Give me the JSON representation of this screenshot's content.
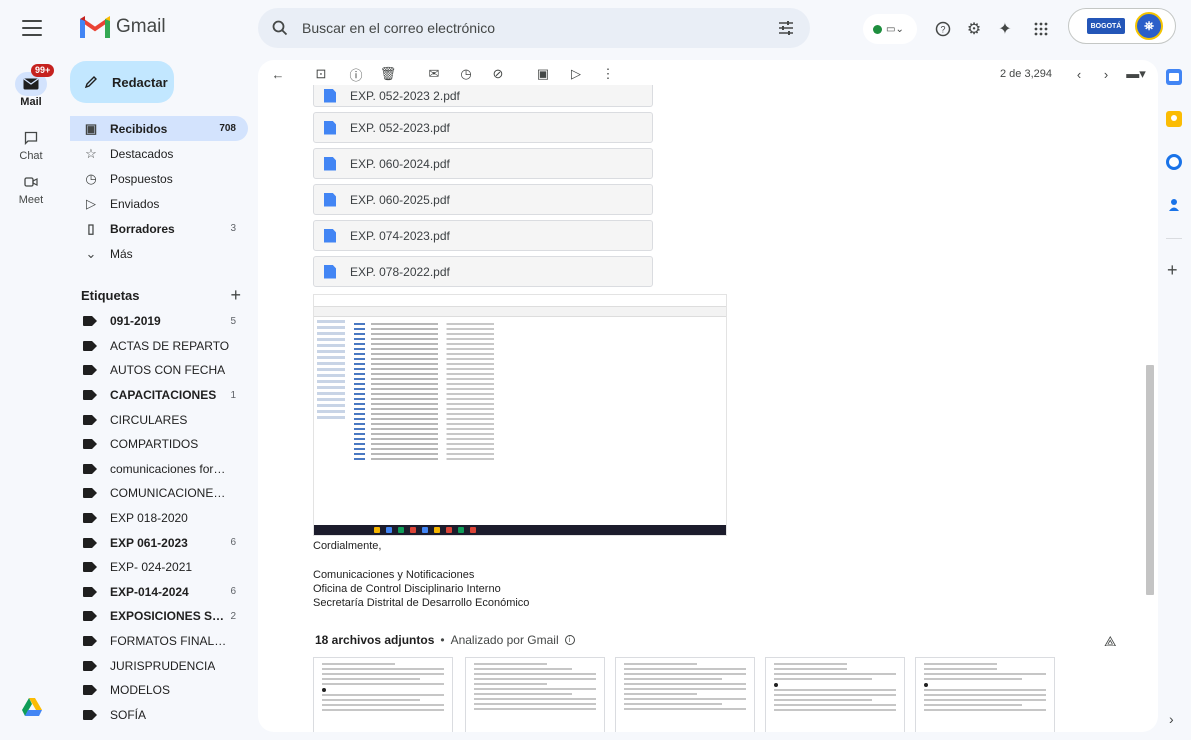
{
  "app": {
    "name": "Gmail"
  },
  "header": {
    "search_placeholder": "Buscar en el correo electrónico",
    "account_logo_text": "BOGOTÁ"
  },
  "rail": {
    "mail_label": "Mail",
    "mail_badge": "99+",
    "chat_label": "Chat",
    "meet_label": "Meet"
  },
  "compose": {
    "label": "Redactar"
  },
  "nav": [
    {
      "label": "Recibidos",
      "count": "708",
      "icon": "inbox-icon",
      "active": true
    },
    {
      "label": "Destacados",
      "count": "",
      "icon": "star-icon"
    },
    {
      "label": "Pospuestos",
      "count": "",
      "icon": "clock-icon"
    },
    {
      "label": "Enviados",
      "count": "",
      "icon": "send-icon"
    },
    {
      "label": "Borradores",
      "count": "3",
      "icon": "draft-icon",
      "bold": true
    },
    {
      "label": "Más",
      "count": "",
      "icon": "chevron-down-icon"
    }
  ],
  "labels_title": "Etiquetas",
  "labels": [
    {
      "name": "091-2019",
      "count": "5",
      "bold": true
    },
    {
      "name": "ACTAS DE REPARTO",
      "count": ""
    },
    {
      "name": "AUTOS CON FECHA",
      "count": ""
    },
    {
      "name": "CAPACITACIONES",
      "count": "1",
      "bold": true
    },
    {
      "name": "CIRCULARES",
      "count": ""
    },
    {
      "name": "COMPARTIDOS",
      "count": ""
    },
    {
      "name": "comunicaciones formato...",
      "count": ""
    },
    {
      "name": "COMUNICACIONES Y/O ...",
      "count": ""
    },
    {
      "name": "EXP 018-2020",
      "count": ""
    },
    {
      "name": "EXP 061-2023",
      "count": "6",
      "bold": true
    },
    {
      "name": "EXP- 024-2021",
      "count": ""
    },
    {
      "name": "EXP-014-2024",
      "count": "6",
      "bold": true
    },
    {
      "name": "EXPOSICIONES SE...",
      "count": "2",
      "bold": true
    },
    {
      "name": "FORMATOS FINALES PR...",
      "count": ""
    },
    {
      "name": "JURISPRUDENCIA",
      "count": ""
    },
    {
      "name": "MODELOS",
      "count": ""
    },
    {
      "name": "SOFÍA",
      "count": ""
    }
  ],
  "toolbar": {
    "pager": "2 de 3,294"
  },
  "pdfs": [
    "EXP. 052-2023 2.pdf",
    "EXP. 052-2023.pdf",
    "EXP. 060-2024.pdf",
    "EXP. 060-2025.pdf",
    "EXP. 074-2023.pdf",
    "EXP. 078-2022.pdf"
  ],
  "signature": {
    "closing": "Cordialmente,",
    "line1": "Comunicaciones y Notificaciones",
    "line2": "Oficina de Control Disciplinario Interno",
    "line3": "Secretaría Distrital de Desarrollo Económico"
  },
  "attachments": {
    "title": "18 archivos adjuntos",
    "subtitle": "Analizado por Gmail",
    "separator": "•"
  },
  "colors": {
    "accent": "#0b57d0",
    "compose_bg": "#c2e7ff",
    "active_nav": "#d3e3fd",
    "badge": "#c5221f"
  }
}
